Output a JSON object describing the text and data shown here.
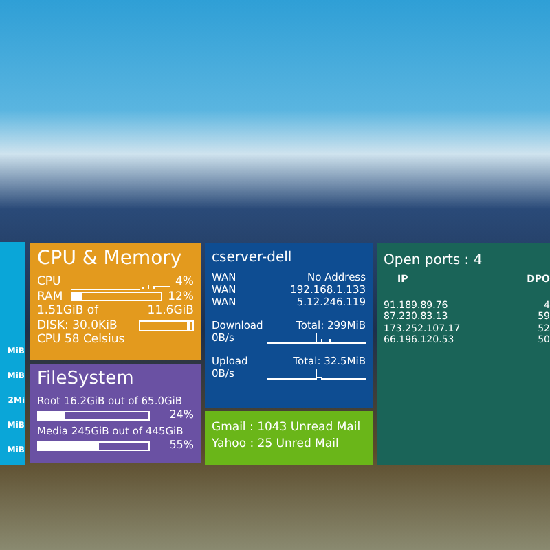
{
  "side_panel": {
    "values": [
      "MiB",
      "MiB",
      "2Mi",
      "MiB",
      "MiB"
    ]
  },
  "cpu_memory": {
    "title": "CPU & Memory",
    "cpu_label": "CPU",
    "cpu_value": "4%",
    "ram_label": "RAM",
    "ram_value": "12%",
    "ram_meter": {
      "level": 0.12
    },
    "used": "1.51GiB of",
    "total": "11.6GiB",
    "disk": "DISK: 30.0KiB",
    "temp": "CPU 58 Celsius"
  },
  "filesystem": {
    "title": "FileSystem",
    "mounts": [
      {
        "label": "Root 16.2GiB out of 65.0GiB",
        "percent": "24%",
        "level": 0.24
      },
      {
        "label": "Media 245GiB out of 445GiB",
        "percent": "55%",
        "level": 0.55
      }
    ]
  },
  "network": {
    "host": "cserver-dell",
    "interfaces": [
      {
        "name": "WAN",
        "address": "No Address"
      },
      {
        "name": "WAN",
        "address": "192.168.1.133"
      },
      {
        "name": "WAN",
        "address": "5.12.246.119"
      }
    ],
    "traffic": [
      {
        "label": "Download",
        "total": "Total: 299MiB",
        "rate": "0B/s"
      },
      {
        "label": "Upload",
        "total": "Total: 32.5MiB",
        "rate": "0B/s"
      }
    ]
  },
  "mail": [
    "Gmail : 1043 Unread Mail",
    "Yahoo : 25 Unred Mail"
  ],
  "ports": {
    "title": "Open ports : 4",
    "columns": [
      "IP",
      "DPO"
    ],
    "rows": [
      [
        "91.189.89.76",
        "4"
      ],
      [
        "87.230.83.13",
        "59"
      ],
      [
        "173.252.107.17",
        "52"
      ],
      [
        "66.196.120.53",
        "50"
      ]
    ]
  }
}
